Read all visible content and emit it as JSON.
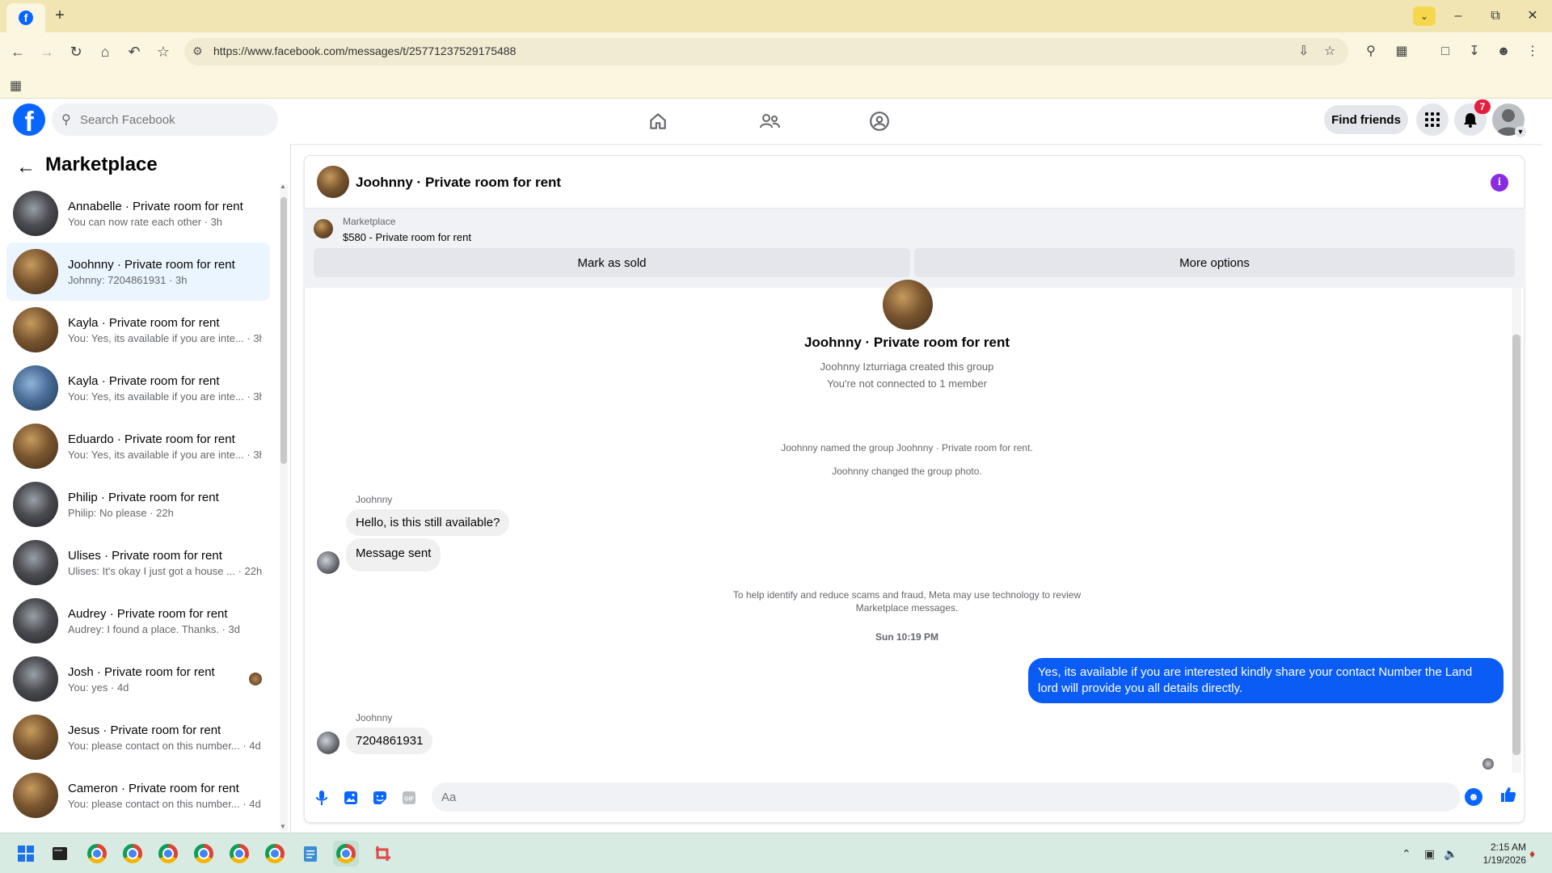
{
  "browser": {
    "url": "https://www.facebook.com/messages/t/25771237529175488",
    "tab_favicon": "f",
    "newtab_label": "+"
  },
  "facebook": {
    "logo_letter": "f",
    "search_placeholder": "Search Facebook",
    "find_friends_label": "Find friends",
    "notification_count": "7"
  },
  "sidebar": {
    "title": "Marketplace",
    "conversations": [
      {
        "name": "Annabelle · Private room for rent",
        "snippet": "You can now rate each other · 3h",
        "avatar": "dark"
      },
      {
        "name": "Joohnny · Private room for rent",
        "snippet": "Johnny: 7204861931 · 3h",
        "avatar": "warm",
        "active": true
      },
      {
        "name": "Kayla · Private room for rent",
        "snippet": "You: Yes, its available if you are inte... · 3h",
        "avatar": "warm"
      },
      {
        "name": "Kayla · Private room for rent",
        "snippet": "You: Yes, its available if you are inte... · 3h",
        "avatar": "blue"
      },
      {
        "name": "Eduardo · Private room for rent",
        "snippet": "You: Yes, its available if you are inte... · 3h",
        "avatar": "warm"
      },
      {
        "name": "Philip · Private room for rent",
        "snippet": "Philip: No please · 22h",
        "avatar": "dark"
      },
      {
        "name": "Ulises · Private room for rent",
        "snippet": "Ulises: It's okay I just got a house ... · 22h",
        "avatar": "dark"
      },
      {
        "name": "Audrey · Private room for rent",
        "snippet": "Audrey: I found a place. Thanks. · 3d",
        "avatar": "dark"
      },
      {
        "name": "Josh · Private room for rent",
        "snippet": "You: yes · 4d",
        "avatar": "dark",
        "seen": true
      },
      {
        "name": "Jesus · Private room for rent",
        "snippet": "You: please contact on this number... · 4d",
        "avatar": "warm"
      },
      {
        "name": "Cameron · Private room for rent",
        "snippet": "You: please contact on this number... · 4d",
        "avatar": "warm"
      }
    ]
  },
  "chat": {
    "title": "Joohnny · Private room for rent",
    "listing": {
      "source": "Marketplace",
      "price_title": "$580 - Private room for rent",
      "mark_sold_label": "Mark as sold",
      "more_options_label": "More options"
    },
    "group": {
      "title": "Joohnny · Private room for rent",
      "created": "Joohnny Izturriaga created this group",
      "connected": "You're not connected to 1 member",
      "named_event": "Joohnny named the group Joohnny · Private room for rent.",
      "photo_event": "Joohnny changed the group photo."
    },
    "messages": {
      "sender1": "Joohnny",
      "msg1": "Hello, is this still available?",
      "msg2": "Message sent",
      "scam_note_line1": "To help identify and reduce scams and fraud, Meta may use technology to review",
      "scam_note_line2": "Marketplace messages.",
      "timestamp": "Sun 10:19 PM",
      "outgoing": "Yes, its available if you are interested kindly share your contact Number the Land lord will provide you all details directly.",
      "sender2": "Joohnny",
      "msg3": "7204861931"
    },
    "composer_placeholder": "Aa"
  },
  "taskbar": {
    "time": "2:15 AM",
    "date": "1/19/2026"
  },
  "colors": {
    "fb_blue": "#0866ff",
    "outgoing_bubble": "#0a5cf5",
    "chrome_tabbar": "#f1e6b3",
    "taskbar": "#d8ebe3"
  }
}
